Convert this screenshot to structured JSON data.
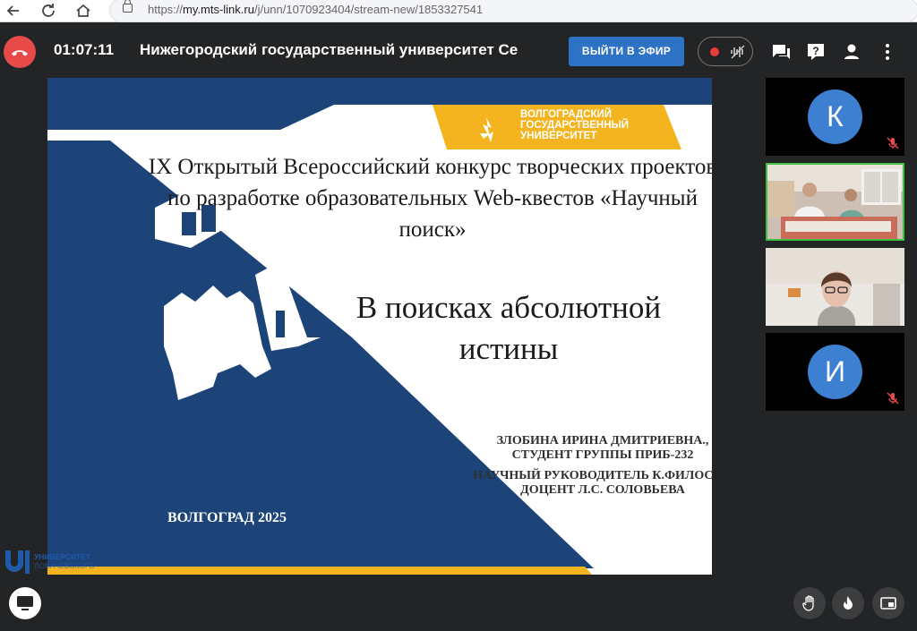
{
  "browser": {
    "url_scheme": "https://",
    "url_host": "my.mts-link.ru",
    "url_path": "/j/unn/1070923404/stream-new/1853327541"
  },
  "meeting": {
    "timer": "01:07:11",
    "title": "Нижегородский государственный университет   Се",
    "go_live_label": "ВЫЙТИ В ЭФИР"
  },
  "slide": {
    "logo_lines": [
      "ВОЛГОГРАДСКИЙ",
      "ГОСУДАРСТВЕННЫЙ",
      "УНИВЕРСИТЕТ"
    ],
    "title": "IX Открытый Всероссийский конкурс творческих проектов по разработке образовательных Web-квестов «Научный поиск»",
    "main_title": "В поисках абсолютной истины",
    "author_line1": "ЗЛОБИНА ИРИНА ДМИТРИЕВНА., СТУДЕНТ ГРУППЫ ПРИБ-232",
    "author_line2": "НАУЧНЫЙ РУКОВОДИТЕЛЬ К.ФИЛОС.Н., ДОЦЕНТ Л.С. СОЛОВЬЕВА",
    "city_year": "ВОЛГОГРАД 2025"
  },
  "watermark": {
    "line1": "УНИВЕРСИТЕТ",
    "line2": "ЛОБАЧЕВСКОГО"
  },
  "participants": [
    {
      "initial": "К",
      "muted": true
    },
    {
      "initial": "",
      "video": true,
      "active": true
    },
    {
      "initial": "",
      "video": true
    },
    {
      "initial": "И",
      "muted": true
    }
  ],
  "colors": {
    "navy": "#1d4479",
    "gold": "#f3b41f",
    "accent_blue": "#2e72c6",
    "hangup_red": "#e84a4a"
  },
  "icons": [
    "back-icon",
    "reload-icon",
    "home-icon",
    "lock-icon",
    "hangup-icon",
    "record-dot-icon",
    "noise-icon",
    "chat-icon",
    "help-icon",
    "person-icon",
    "more-icon",
    "mic-off-icon",
    "screen-share-icon",
    "raise-hand-icon",
    "reaction-icon",
    "layout-icon"
  ]
}
